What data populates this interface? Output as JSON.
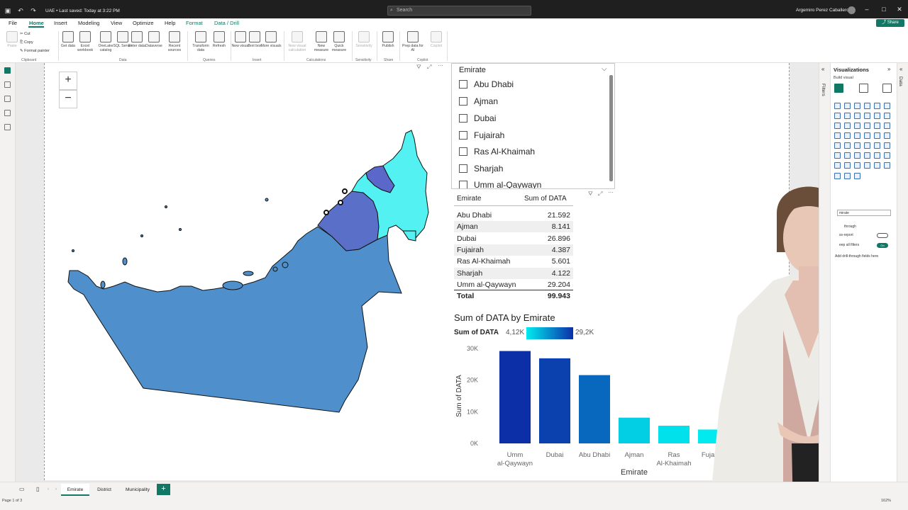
{
  "titlebar": {
    "doc_title": "UAE • Last saved: Today at 3:22 PM",
    "search_placeholder": "Search",
    "user_name": "Argemiro Perez Caballero"
  },
  "menu": {
    "items": [
      "File",
      "Home",
      "Insert",
      "Modeling",
      "View",
      "Optimize",
      "Help",
      "Format",
      "Data / Drill"
    ],
    "active": "Home",
    "share_label": "Share"
  },
  "ribbon": {
    "clipboard": {
      "paste": "Paste",
      "cut": "Cut",
      "copy": "Copy",
      "format_painter": "Format painter",
      "group": "Clipboard"
    },
    "data": {
      "buttons": [
        "Get data",
        "Excel workbook",
        "OneLake catalog",
        "SQL Server",
        "Enter data",
        "Dataverse",
        "Recent sources"
      ],
      "group": "Data"
    },
    "queries": {
      "buttons": [
        "Transform data",
        "Refresh"
      ],
      "group": "Queries"
    },
    "insert": {
      "buttons": [
        "New visual",
        "Text box",
        "More visuals"
      ],
      "group": "Insert"
    },
    "calculations": {
      "buttons": [
        "New visual calculation",
        "New measure",
        "Quick measure"
      ],
      "group": "Calculations"
    },
    "sensitivity": {
      "buttons": [
        "Sensitivity"
      ],
      "group": "Sensitivity"
    },
    "share": {
      "buttons": [
        "Publish"
      ],
      "group": "Share"
    },
    "copilot": {
      "buttons": [
        "Prep data for AI",
        "Copilot"
      ],
      "group": "Copilot"
    }
  },
  "slicer": {
    "title": "Emirate",
    "items": [
      "Abu Dhabi",
      "Ajman",
      "Dubai",
      "Fujairah",
      "Ras Al-Khaimah",
      "Sharjah",
      "Umm al-Qaywayn"
    ]
  },
  "table": {
    "headers": [
      "Emirate",
      "Sum of DATA"
    ],
    "rows": [
      {
        "emirate": "Abu Dhabi",
        "value": "21.592"
      },
      {
        "emirate": "Ajman",
        "value": "8.141"
      },
      {
        "emirate": "Dubai",
        "value": "26.896"
      },
      {
        "emirate": "Fujairah",
        "value": "4.387"
      },
      {
        "emirate": "Ras Al-Khaimah",
        "value": "5.601"
      },
      {
        "emirate": "Sharjah",
        "value": "4.122"
      },
      {
        "emirate": "Umm al-Qaywayn",
        "value": "29.204"
      }
    ],
    "total_label": "Total",
    "total_value": "99.943"
  },
  "chart_data": {
    "type": "bar",
    "title": "Sum of DATA by Emirate",
    "legend": {
      "name": "Sum of DATA",
      "min_label": "4,12K",
      "max_label": "29,2K",
      "color_min": "#00ecf0",
      "color_max": "#0c2fa8"
    },
    "categories": [
      "Umm al-Qaywayn",
      "Dubai",
      "Abu Dhabi",
      "Ajman",
      "Ras Al-Khaimah",
      "Fujairah",
      "Sharjah"
    ],
    "category_labels": [
      [
        "Umm",
        "al-Qaywayn"
      ],
      [
        "Dubai"
      ],
      [
        "Abu Dhabi"
      ],
      [
        "Ajman"
      ],
      [
        "Ras",
        "Al-Khaimah"
      ],
      [
        "Fujairah"
      ],
      [
        ""
      ]
    ],
    "values": [
      29204,
      26896,
      21592,
      8141,
      5601,
      4387,
      4122
    ],
    "xlabel": "Emirate",
    "ylabel": "Sum of DATA",
    "ylim": [
      0,
      30000
    ],
    "yticks": [
      {
        "v": 0,
        "label": "0K"
      },
      {
        "v": 10000,
        "label": "10K"
      },
      {
        "v": 20000,
        "label": "20K"
      },
      {
        "v": 30000,
        "label": "30K"
      }
    ]
  },
  "map": {
    "zoom_in": "+",
    "zoom_out": "−",
    "colors": {
      "abu_dhabi": "#4f8fcc",
      "dubai": "#5a6fc8",
      "ras_al_khaimah": "#5b67c9",
      "northern": "#53f1f1"
    }
  },
  "panes": {
    "filters_label": "Filters",
    "visualizations_title": "Visualizations",
    "build_visual": "Build visual",
    "data_label": "Data",
    "drill_through": "through",
    "cross_report": "ss-report",
    "keep_filters": "eep all filters",
    "toggle_on": "On",
    "drill_hint": "Add drill-through fields here",
    "field_well_value": "mirate"
  },
  "pages": {
    "tabs": [
      "Emirate",
      "District",
      "Municipality"
    ],
    "active": "Emirate",
    "indicator": "Page 1 of 3",
    "zoom": "162%"
  }
}
